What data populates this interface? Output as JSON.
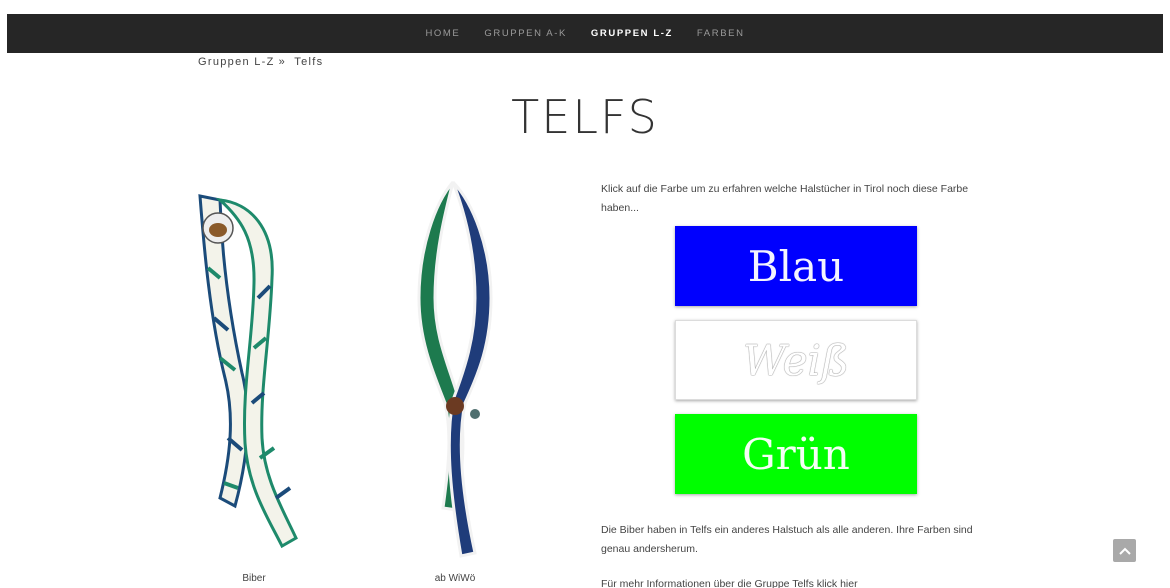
{
  "nav": {
    "items": [
      {
        "label": "HOME",
        "active": false
      },
      {
        "label": "GRUPPEN A-K",
        "active": false
      },
      {
        "label": "GRUPPEN L-Z",
        "active": true
      },
      {
        "label": "FARBEN",
        "active": false
      }
    ]
  },
  "breadcrumb": {
    "parent": "Gruppen L-Z",
    "separator": "»",
    "current": "Telfs"
  },
  "page": {
    "title": "TELFS"
  },
  "scarves": [
    {
      "caption": "Biber",
      "icon": "scarf-white-green-blue"
    },
    {
      "caption": "ab WiWö",
      "icon": "scarf-green-blue"
    }
  ],
  "content": {
    "intro": "Klick auf die Farbe um zu erfahren welche Halstücher in Tirol noch diese Farbe haben...",
    "color_buttons": [
      {
        "label": "Blau",
        "color": "#0000fe"
      },
      {
        "label": "Weiß",
        "color": "#ffffff"
      },
      {
        "label": "Grün",
        "color": "#00fe00"
      }
    ],
    "info": "Die Biber haben in Telfs ein anderes Halstuch als alle anderen. Ihre Farben sind genau andersherum.",
    "more_info": "Für mehr Informationen über die Gruppe Telfs klick hier"
  },
  "colors": {
    "navbar": "#262626",
    "nav_active": "#ffffff",
    "nav_inactive": "#9a9a9a",
    "scroll_button": "#a9a9a9"
  },
  "scroll_top": {
    "icon": "chevron-up-icon"
  }
}
